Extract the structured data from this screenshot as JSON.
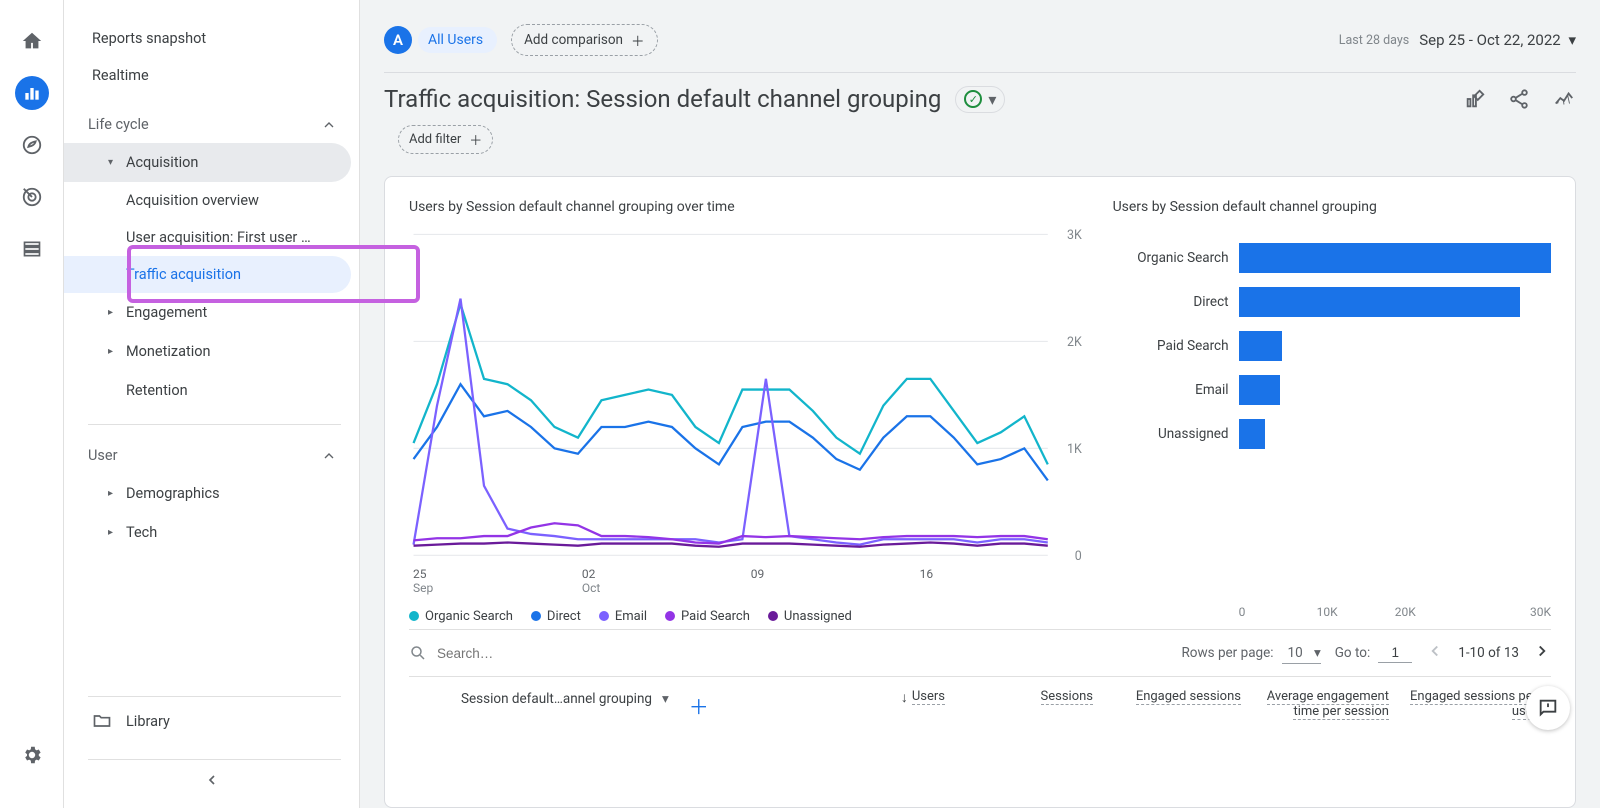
{
  "rail": {
    "home": "home",
    "reports": "reports",
    "explore": "explore",
    "ads": "ads",
    "config": "config",
    "settings": "settings"
  },
  "sidebar": {
    "reports_snapshot": "Reports snapshot",
    "realtime": "Realtime",
    "life_cycle": "Life cycle",
    "acquisition": "Acquisition",
    "leaf_overview": "Acquisition overview",
    "leaf_user_acq": "User acquisition: First user …",
    "leaf_traffic_acq": "Traffic acquisition",
    "engagement": "Engagement",
    "monetization": "Monetization",
    "retention": "Retention",
    "user": "User",
    "demographics": "Demographics",
    "tech": "Tech",
    "library": "Library"
  },
  "header": {
    "all_users": "All Users",
    "add_comparison": "Add comparison",
    "last_28": "Last 28 days",
    "date_range": "Sep 25 - Oct 22, 2022",
    "title": "Traffic acquisition: Session default channel grouping",
    "add_filter": "Add filter"
  },
  "card": {
    "line_title": "Users by Session default channel grouping over time",
    "bar_title": "Users by Session default channel grouping",
    "y_ticks": [
      "3K",
      "2K",
      "1K",
      "0"
    ],
    "x_ticks": [
      {
        "d": "25",
        "m": "Sep"
      },
      {
        "d": "02",
        "m": "Oct"
      },
      {
        "d": "09",
        "m": ""
      },
      {
        "d": "16",
        "m": ""
      }
    ],
    "legend": [
      {
        "name": "Organic Search",
        "color": "#12b5cb"
      },
      {
        "name": "Direct",
        "color": "#1a73e8"
      },
      {
        "name": "Email",
        "color": "#7b61ff"
      },
      {
        "name": "Paid Search",
        "color": "#9334e6"
      },
      {
        "name": "Unassigned",
        "color": "#6a1b9a"
      }
    ],
    "bar_axis": [
      "0",
      "10K",
      "20K",
      "30K"
    ]
  },
  "table": {
    "search_placeholder": "Search…",
    "rows_per_page": "Rows per page:",
    "rpp_value": "10",
    "goto": "Go to:",
    "goto_value": "1",
    "range": "1-10 of 13",
    "dimension": "Session default…annel grouping",
    "cols": [
      "Users",
      "Sessions",
      "Engaged sessions",
      "Average engagement time per session",
      "Engaged sessions per user"
    ]
  },
  "chart_data": [
    {
      "type": "line",
      "title": "Users by Session default channel grouping over time",
      "xlabel": "",
      "ylabel": "Users",
      "ylim": [
        0,
        3000
      ],
      "x": [
        "Sep 25",
        "Sep 26",
        "Sep 27",
        "Sep 28",
        "Sep 29",
        "Sep 30",
        "Oct 01",
        "Oct 02",
        "Oct 03",
        "Oct 04",
        "Oct 05",
        "Oct 06",
        "Oct 07",
        "Oct 08",
        "Oct 09",
        "Oct 10",
        "Oct 11",
        "Oct 12",
        "Oct 13",
        "Oct 14",
        "Oct 15",
        "Oct 16",
        "Oct 17",
        "Oct 18",
        "Oct 19",
        "Oct 20",
        "Oct 21",
        "Oct 22"
      ],
      "series": [
        {
          "name": "Organic Search",
          "color": "#12b5cb",
          "values": [
            1050,
            1600,
            2350,
            1650,
            1600,
            1450,
            1200,
            1100,
            1450,
            1500,
            1550,
            1500,
            1200,
            1050,
            1550,
            1550,
            1550,
            1350,
            1100,
            950,
            1400,
            1650,
            1650,
            1350,
            1050,
            1150,
            1300,
            850
          ]
        },
        {
          "name": "Direct",
          "color": "#1a73e8",
          "values": [
            900,
            1200,
            1600,
            1300,
            1350,
            1200,
            1000,
            950,
            1200,
            1200,
            1250,
            1200,
            1000,
            850,
            1200,
            1250,
            1250,
            1100,
            900,
            800,
            1100,
            1300,
            1300,
            1100,
            850,
            900,
            1000,
            700
          ]
        },
        {
          "name": "Email",
          "color": "#7b61ff",
          "values": [
            100,
            1400,
            2400,
            650,
            250,
            200,
            180,
            150,
            150,
            150,
            150,
            150,
            150,
            120,
            150,
            1650,
            180,
            150,
            120,
            100,
            150,
            150,
            150,
            150,
            120,
            150,
            150,
            120
          ]
        },
        {
          "name": "Paid Search",
          "color": "#9334e6",
          "values": [
            140,
            160,
            160,
            180,
            180,
            260,
            300,
            280,
            180,
            180,
            170,
            150,
            120,
            110,
            180,
            170,
            180,
            170,
            160,
            150,
            170,
            180,
            180,
            180,
            170,
            180,
            180,
            150
          ]
        },
        {
          "name": "Unassigned",
          "color": "#6a1b9a",
          "values": [
            90,
            100,
            110,
            110,
            120,
            110,
            100,
            90,
            110,
            110,
            110,
            110,
            90,
            80,
            110,
            110,
            110,
            100,
            90,
            80,
            100,
            110,
            120,
            110,
            90,
            110,
            110,
            90
          ]
        }
      ]
    },
    {
      "type": "bar",
      "title": "Users by Session default channel grouping",
      "xlabel": "",
      "ylabel": "",
      "xlim": [
        0,
        30000
      ],
      "categories": [
        "Organic Search",
        "Direct",
        "Paid Search",
        "Email",
        "Unassigned"
      ],
      "values": [
        30000,
        27000,
        4200,
        4000,
        2500
      ]
    }
  ]
}
